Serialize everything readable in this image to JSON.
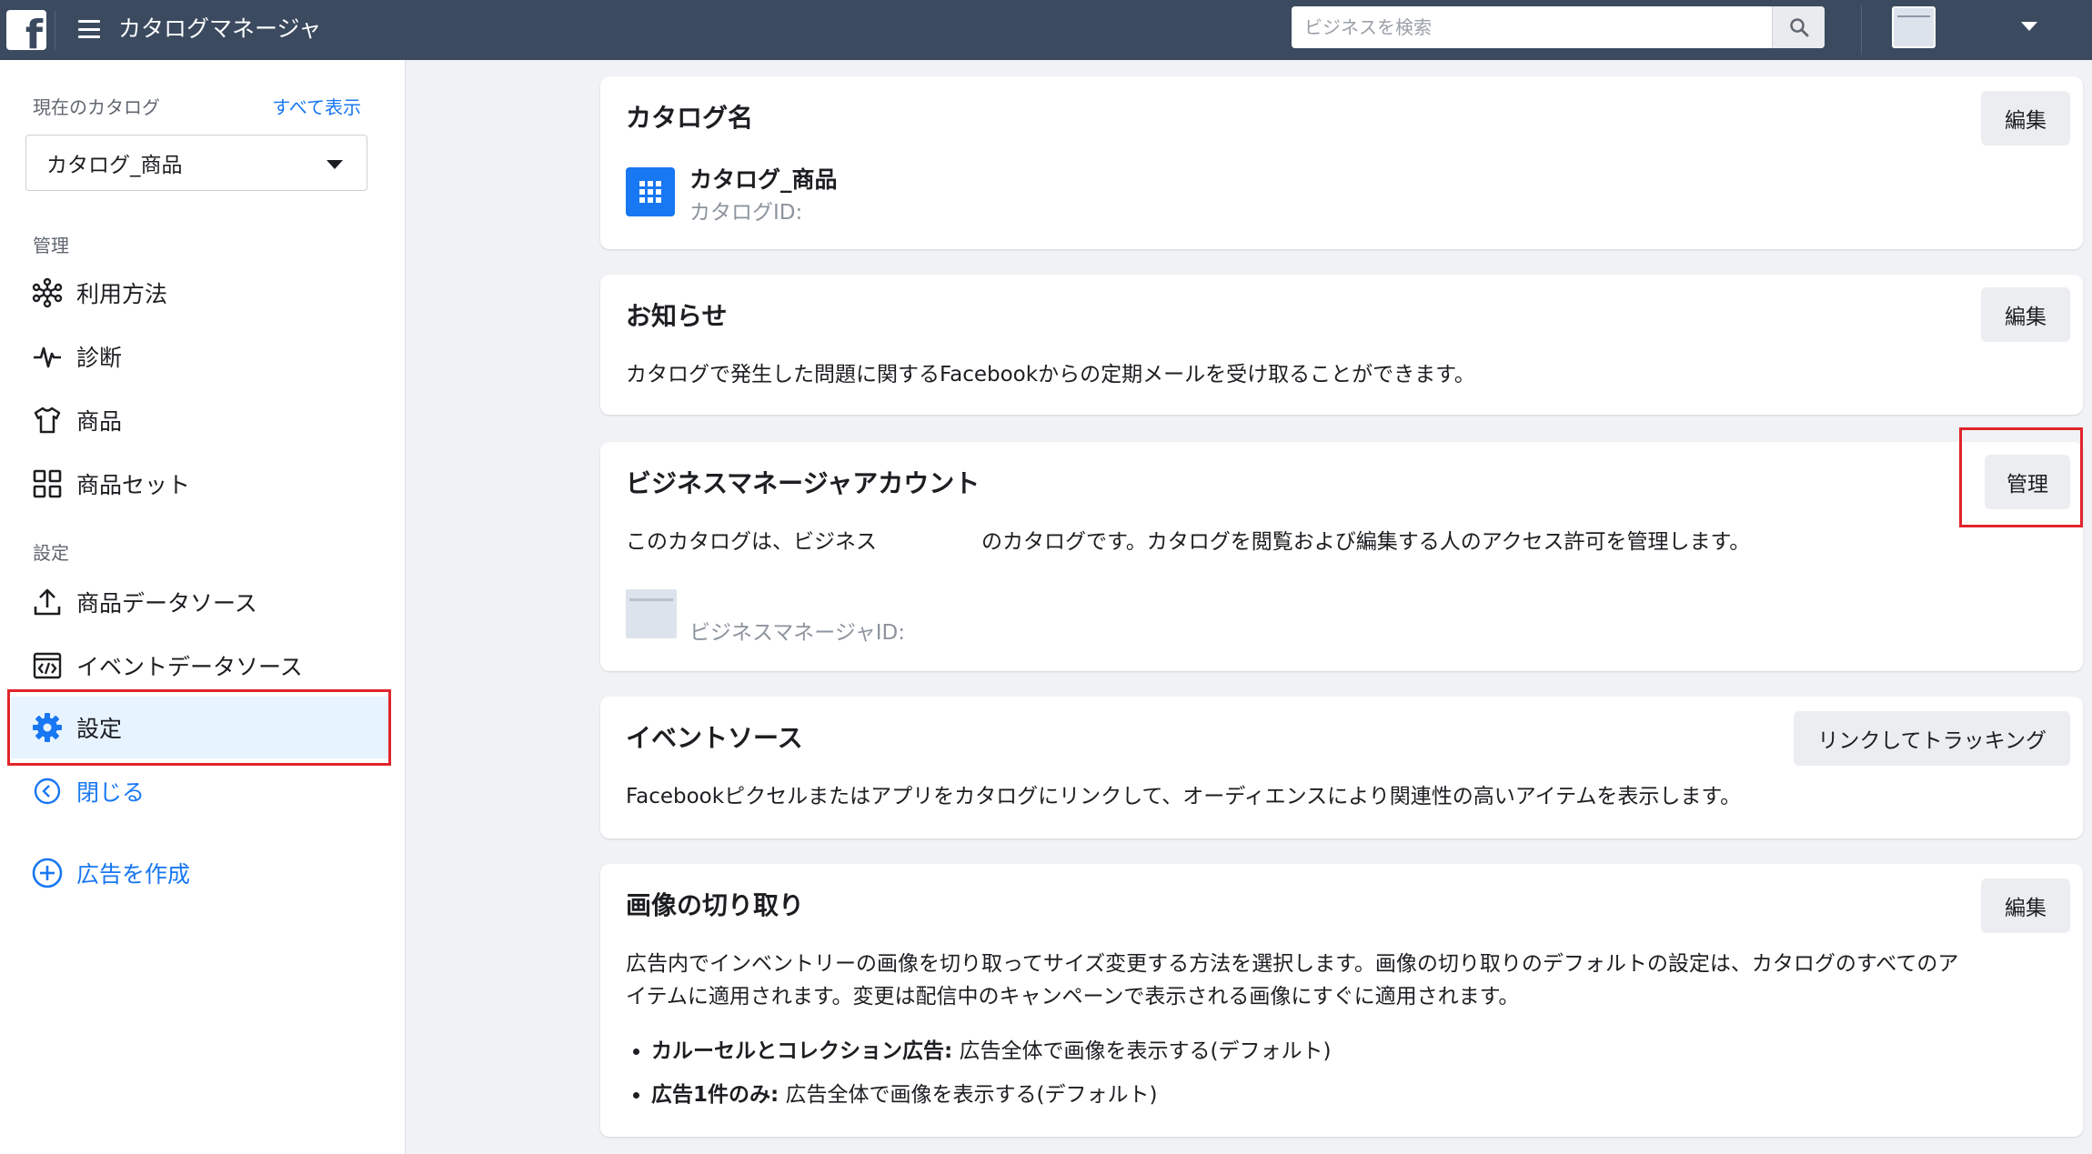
{
  "topbar": {
    "logo_letter": "f",
    "app_title": "カタログマネージャ",
    "search_placeholder": "ビジネスを検索"
  },
  "sidebar": {
    "current_catalog_label": "現在のカタログ",
    "show_all": "すべて表示",
    "catalog_name": "カタログ_商品",
    "section_manage": "管理",
    "section_settings": "設定",
    "items": [
      {
        "label": "利用方法",
        "icon": "network-icon"
      },
      {
        "label": "診断",
        "icon": "pulse-icon"
      },
      {
        "label": "商品",
        "icon": "shirt-icon"
      },
      {
        "label": "商品セット",
        "icon": "grid-icon"
      },
      {
        "label": "商品データソース",
        "icon": "upload-icon"
      },
      {
        "label": "イベントデータソース",
        "icon": "code-window-icon"
      },
      {
        "label": "設定",
        "icon": "gear-icon"
      },
      {
        "label": "閉じる",
        "icon": "chevron-left-circle-icon"
      },
      {
        "label": "広告を作成",
        "icon": "plus-circle-icon"
      }
    ]
  },
  "cards": {
    "catalog": {
      "title": "カタログ名",
      "button": "編集",
      "name": "カタログ_商品",
      "id_label": "カタログID:"
    },
    "notice": {
      "title": "お知らせ",
      "button": "編集",
      "text": "カタログで発生した問題に関するFacebookからの定期メールを受け取ることができます。"
    },
    "business": {
      "title": "ビジネスマネージャアカウント",
      "button": "管理",
      "text": "このカタログは、ビジネス　　　　　のカタログです。カタログを閲覧および編集する人のアクセス許可を管理します。",
      "id_label": "ビジネスマネージャID:"
    },
    "event": {
      "title": "イベントソース",
      "button": "リンクしてトラッキング",
      "text": "Facebookピクセルまたはアプリをカタログにリンクして、オーディエンスにより関連性の高いアイテムを表示します。"
    },
    "crop": {
      "title": "画像の切り取り",
      "button": "編集",
      "text_line1": "広告内でインベントリーの画像を切り取ってサイズ変更する方法を選択します。画像の切り取りのデフォルトの設定は、カタログのすべてのア",
      "text_line2": "イテムに適用されます。変更は配信中のキャンペーンで表示される画像にすぐに適用されます。",
      "bullets": [
        {
          "bold": "カルーセルとコレクション広告:",
          "rest": " 広告全体で画像を表示する(デフォルト)"
        },
        {
          "bold": "広告1件のみ:",
          "rest": " 広告全体で画像を表示する(デフォルト)"
        }
      ]
    }
  },
  "colors": {
    "topbar": "#3b4a5f",
    "accent": "#1877f2",
    "highlight": "#e0252b",
    "active_bg": "#e7f3ff"
  }
}
